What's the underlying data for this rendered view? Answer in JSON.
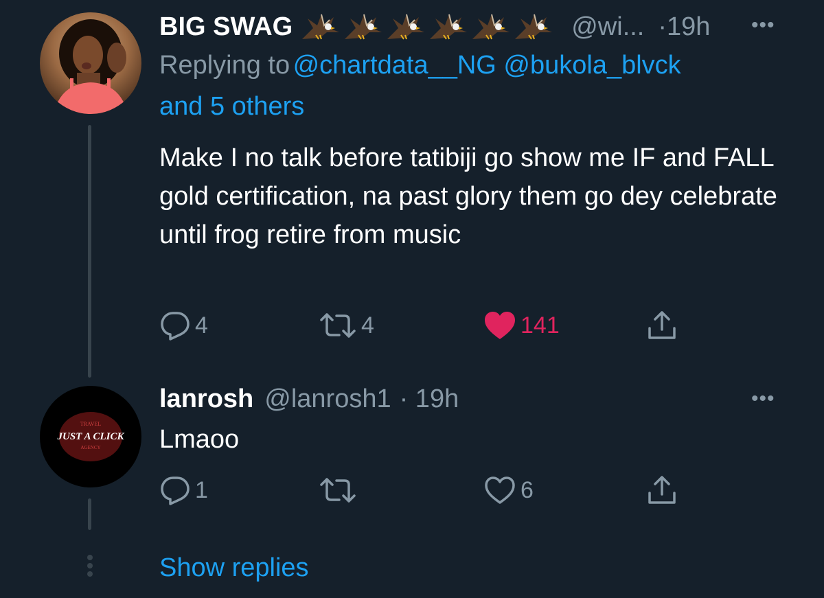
{
  "tweet1": {
    "display_name": "BIG SWAG",
    "emoji_icon": "eagle-emoji",
    "emoji_count": 6,
    "handle": "@wi...",
    "time": "·19h",
    "reply_prefix": "Replying to",
    "reply_mentions": "@chartdata__NG @bukola_blvck",
    "reply_others": "and 5 others",
    "text": "Make I no talk before tatibiji go show me IF and FALL gold certification, na past glory them go dey celebrate until frog retire from music",
    "reply_count": "4",
    "retweet_count": "4",
    "like_count": "141",
    "liked": true
  },
  "tweet2": {
    "display_name": "lanrosh",
    "handle": "@lanrosh1",
    "time": "· 19h",
    "text": "Lmaoo",
    "reply_count": "1",
    "retweet_count": "",
    "like_count": "6",
    "liked": false,
    "avatar": {
      "logo_top": "TRAVEL",
      "logo_main": "JUST A CLICK",
      "logo_bottom": "AGENCY"
    }
  },
  "show_replies": "Show replies",
  "colors": {
    "background": "#15202b",
    "primary_text": "#ffffff",
    "secondary_text": "#8899a6",
    "accent": "#1da1f2",
    "like": "#e0245e",
    "thread_line": "#38444d"
  }
}
